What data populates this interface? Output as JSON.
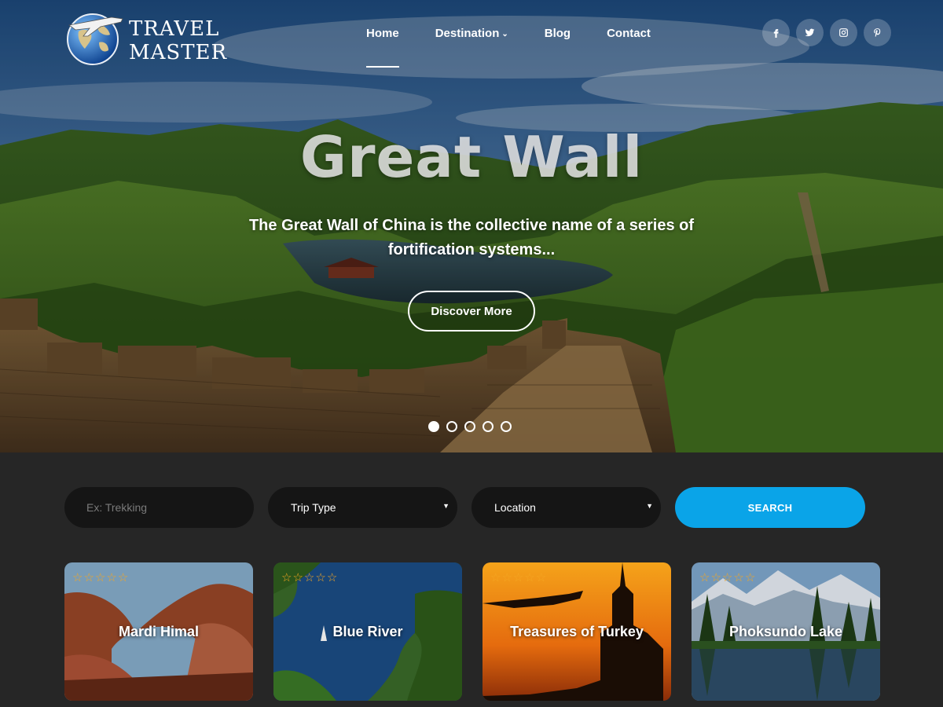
{
  "brand": {
    "line1": "TRAVEL",
    "line2": "MASTER"
  },
  "nav": [
    {
      "label": "Home",
      "active": true
    },
    {
      "label": "Destination",
      "has_dropdown": true
    },
    {
      "label": "Blog"
    },
    {
      "label": "Contact"
    }
  ],
  "social": [
    {
      "icon": "facebook-icon",
      "glyph": "f"
    },
    {
      "icon": "twitter-icon"
    },
    {
      "icon": "instagram-icon"
    },
    {
      "icon": "pinterest-icon"
    }
  ],
  "hero": {
    "title": "Great Wall",
    "description": "The Great Wall of China is the collective name of a series of fortification systems...",
    "button": "Discover More",
    "slides": 5,
    "active_slide": 1
  },
  "search": {
    "keyword_placeholder": "Ex: Trekking",
    "trip_type": "Trip Type",
    "location": "Location",
    "button": "SEARCH"
  },
  "trips": [
    {
      "title": "Mardi Himal",
      "rating": 0
    },
    {
      "title": "Blue River",
      "rating": 0
    },
    {
      "title": "Treasures of Turkey",
      "rating": 0
    },
    {
      "title": "Phoksundo Lake",
      "rating": 0
    }
  ],
  "colors": {
    "accent": "#0aa4e8",
    "star": "#f4a623",
    "page_bg": "#262626",
    "field_bg": "#151515"
  }
}
